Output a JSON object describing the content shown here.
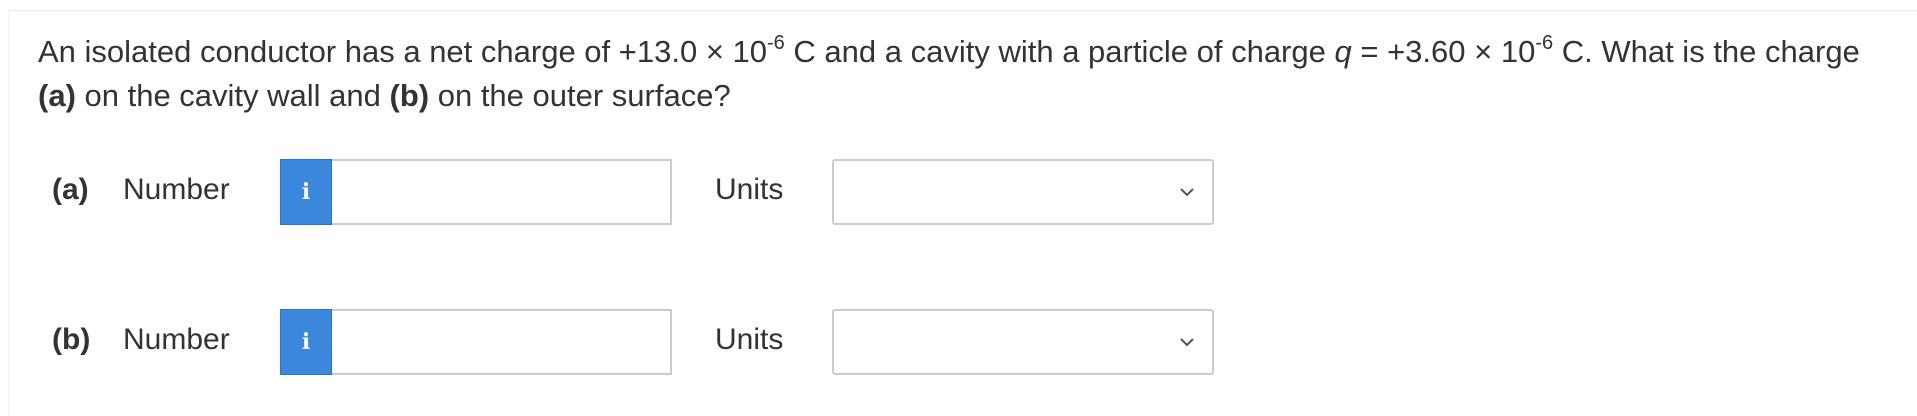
{
  "question": {
    "text_1": "An isolated conductor has a net charge of +13.0 × 10",
    "exp_1": "-6",
    "text_2": " C and a cavity with a particle of charge ",
    "var_q": "q",
    "text_3": " = +3.60 × 10",
    "exp_2": "-6",
    "text_4": " C. What is the charge",
    "part_a_bold": "(a)",
    "text_5": " on the cavity wall and ",
    "part_b_bold": "(b)",
    "text_6": " on the outer surface?"
  },
  "rows": [
    {
      "part": "(a)",
      "number_label": "Number",
      "info_icon": "i",
      "number_value": "",
      "units_label": "Units",
      "units_value": ""
    },
    {
      "part": "(b)",
      "number_label": "Number",
      "info_icon": "i",
      "number_value": "",
      "units_label": "Units",
      "units_value": ""
    }
  ],
  "colors": {
    "info_button": "#3b87dd",
    "border": "#cccccc",
    "text": "#333333"
  }
}
